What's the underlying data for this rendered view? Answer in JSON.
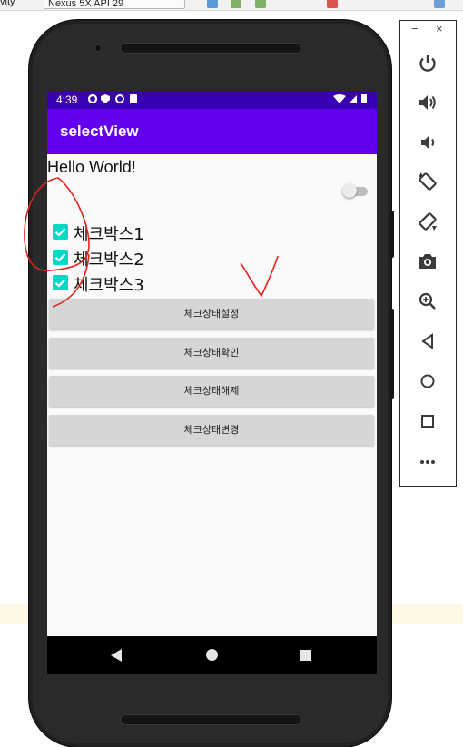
{
  "ide": {
    "left_text": "vity",
    "device_label": "Nexus 5X API 29"
  },
  "status_bar": {
    "time": "4:39"
  },
  "app_bar": {
    "title": "selectView"
  },
  "content": {
    "hello_text": "Hello World!",
    "switch_checked": false,
    "checkboxes": [
      {
        "label": "체크박스1",
        "checked": true
      },
      {
        "label": "체크박스2",
        "checked": true
      },
      {
        "label": "체크박스3",
        "checked": true
      }
    ],
    "buttons": [
      {
        "label": "체크상태설정"
      },
      {
        "label": "체크상태확인"
      },
      {
        "label": "체크상태해제"
      },
      {
        "label": "체크상태변경"
      }
    ]
  },
  "emulator_panel": {
    "minimize": "−",
    "close": "×"
  },
  "colors": {
    "status_bar": "#3700b3",
    "app_bar": "#6200ee",
    "checkbox": "#03dac5",
    "annotation": "#e0251f"
  }
}
